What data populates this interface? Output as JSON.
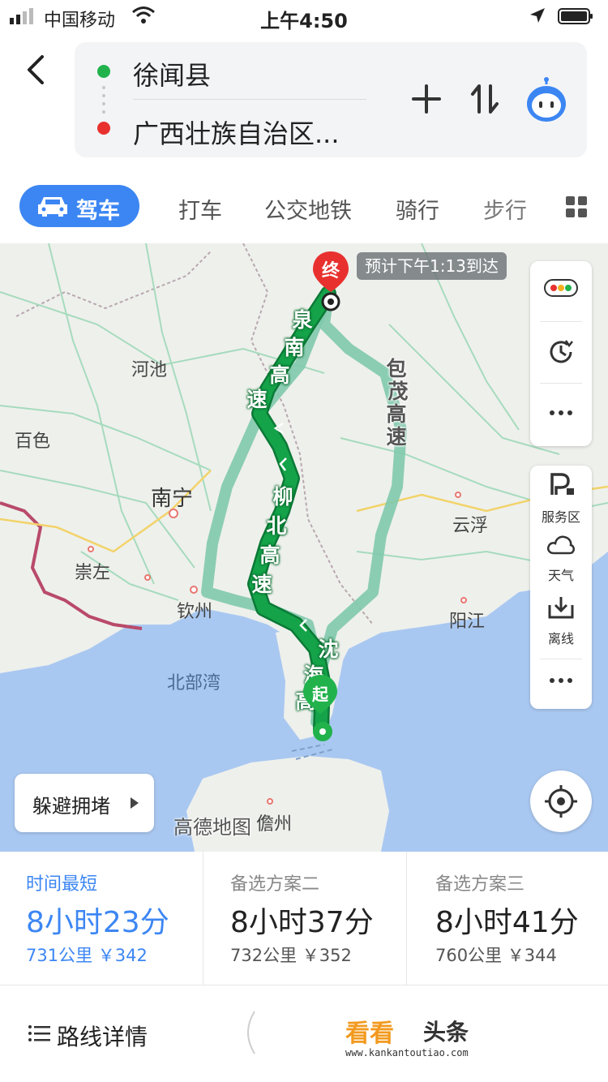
{
  "status_bar": {
    "carrier": "中国移动",
    "time": "上午4:50"
  },
  "route": {
    "origin": "徐闻县",
    "destination": "广西壮族自治区..."
  },
  "modes": {
    "drive": "驾车",
    "taxi": "打车",
    "transit": "公交地铁",
    "bike": "骑行",
    "walk": "步行"
  },
  "map": {
    "eta": "预计下午1:13到达",
    "end_marker": "终",
    "start_marker": "起",
    "cities": {
      "hechi": "河池",
      "baise": "百色",
      "nanning": "南宁",
      "chongzuo": "崇左",
      "qinzhou": "钦州",
      "yunfu": "云浮",
      "yangjiang": "阳江",
      "danzhou": "儋州"
    },
    "sea": "北部湾",
    "roads": {
      "quannan": [
        "泉",
        "南",
        "高",
        "速"
      ],
      "liubei": [
        "柳",
        "北",
        "高",
        "速"
      ],
      "shenhai": [
        "沈",
        "海",
        "高"
      ],
      "baomao": [
        "包",
        "茂",
        "高",
        "速"
      ]
    },
    "avoid_button": "躲避拥堵",
    "logo_text": "高德地图",
    "tools": {
      "service_area": "服务区",
      "weather": "天气",
      "offline": "离线"
    },
    "colors": {
      "primary_route": "#15a34a",
      "alt_route": "#7fc9ad",
      "water": "#a9c8f1",
      "land": "#eef0ec",
      "border": "#b94a6a"
    }
  },
  "plans": [
    {
      "tag": "时间最短",
      "time": "8小时23分",
      "meta": "731公里 ￥342",
      "selected": true
    },
    {
      "tag": "备选方案二",
      "time": "8小时37分",
      "meta": "732公里 ￥352",
      "selected": false
    },
    {
      "tag": "备选方案三",
      "time": "8小时41分",
      "meta": "760公里 ￥344",
      "selected": false
    }
  ],
  "bottom": {
    "details": "路线详情",
    "watermark_title1": "看看",
    "watermark_title2": "头条",
    "watermark_url": "www.kankantoutiao.com"
  },
  "accent_color": "#3c86f3"
}
